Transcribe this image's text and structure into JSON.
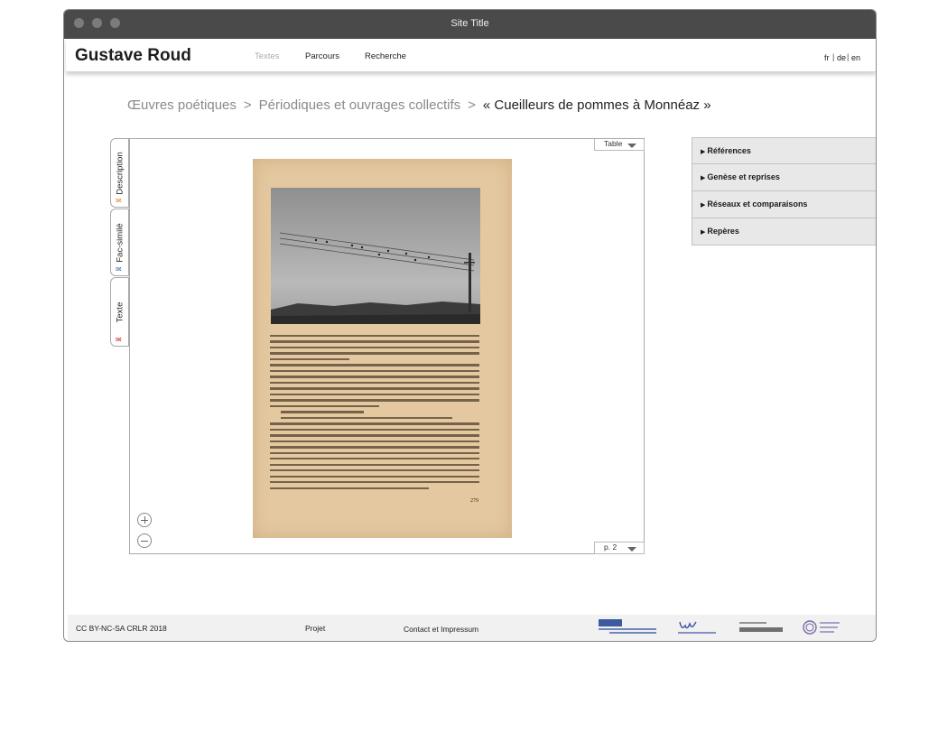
{
  "window": {
    "title": "Site Title"
  },
  "header": {
    "site_name": "Gustave Roud",
    "nav": [
      {
        "label": "Textes",
        "active": true
      },
      {
        "label": "Parcours",
        "active": false
      },
      {
        "label": "Recherche",
        "active": false
      }
    ],
    "languages": [
      "fr",
      "de",
      "en"
    ],
    "lang_separator": "|"
  },
  "breadcrumb": {
    "items": [
      "Œuvres poétiques",
      "Périodiques et ouvrages collectifs"
    ],
    "separator": ">",
    "current": "« Cueilleurs de pommes à Monnéaz »"
  },
  "side_tabs": [
    {
      "label": "Description",
      "mark_icon": "envelope-icon",
      "mark_color": "#e08020"
    },
    {
      "label": "Fac-similé",
      "mark_icon": "envelope-icon",
      "mark_color": "#3a6aa8"
    },
    {
      "label": "Texte",
      "mark_icon": "envelope-icon",
      "mark_color": "#d02020"
    }
  ],
  "viewer": {
    "top_select": "Table",
    "page_select": "p. 2",
    "scan_page_number": "279",
    "zoom_in_icon": "zoom-in-icon",
    "zoom_out_icon": "zoom-out-icon"
  },
  "accordion": [
    {
      "label": "Références"
    },
    {
      "label": "Genèse et reprises"
    },
    {
      "label": "Réseaux et comparaisons"
    },
    {
      "label": "Repères"
    }
  ],
  "footer": {
    "license": "CC BY-NC-SA CRLR 2018",
    "project": "Projet",
    "contact": "Contact et Impressum",
    "logos": [
      "fns-snf-logo",
      "unil-logo",
      "gustave-roud-association-logo",
      "clsr-logo"
    ]
  }
}
